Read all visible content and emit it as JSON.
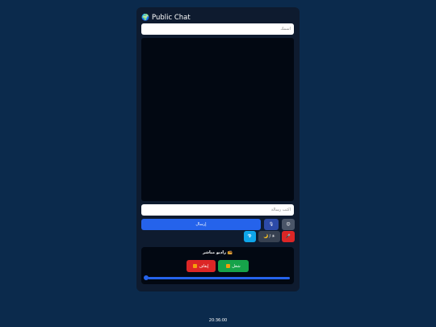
{
  "header": {
    "title": "Public Chat",
    "icon": "globe-icon"
  },
  "name_field": {
    "placeholder": "اسمك"
  },
  "message_field": {
    "placeholder": "اكتب رسالة"
  },
  "buttons": {
    "send_label": "إرسال",
    "mic_icon": "🎙",
    "emoji_icon": "😊",
    "link_icon": "💎",
    "theme_sun": "☀",
    "theme_sep": "/",
    "theme_moon": "🌙",
    "red_icon": "🎤"
  },
  "radio": {
    "title": "📻 راديو مباشر",
    "play_label": "شغل",
    "stop_label": "إيقاف",
    "progress": 0
  },
  "footer": {
    "clock": "20:36:00"
  },
  "colors": {
    "background": "#0b2a4c",
    "panel": "#0e1b2f",
    "send": "#2563eb",
    "play": "#16a34a",
    "stop": "#dc2626"
  }
}
